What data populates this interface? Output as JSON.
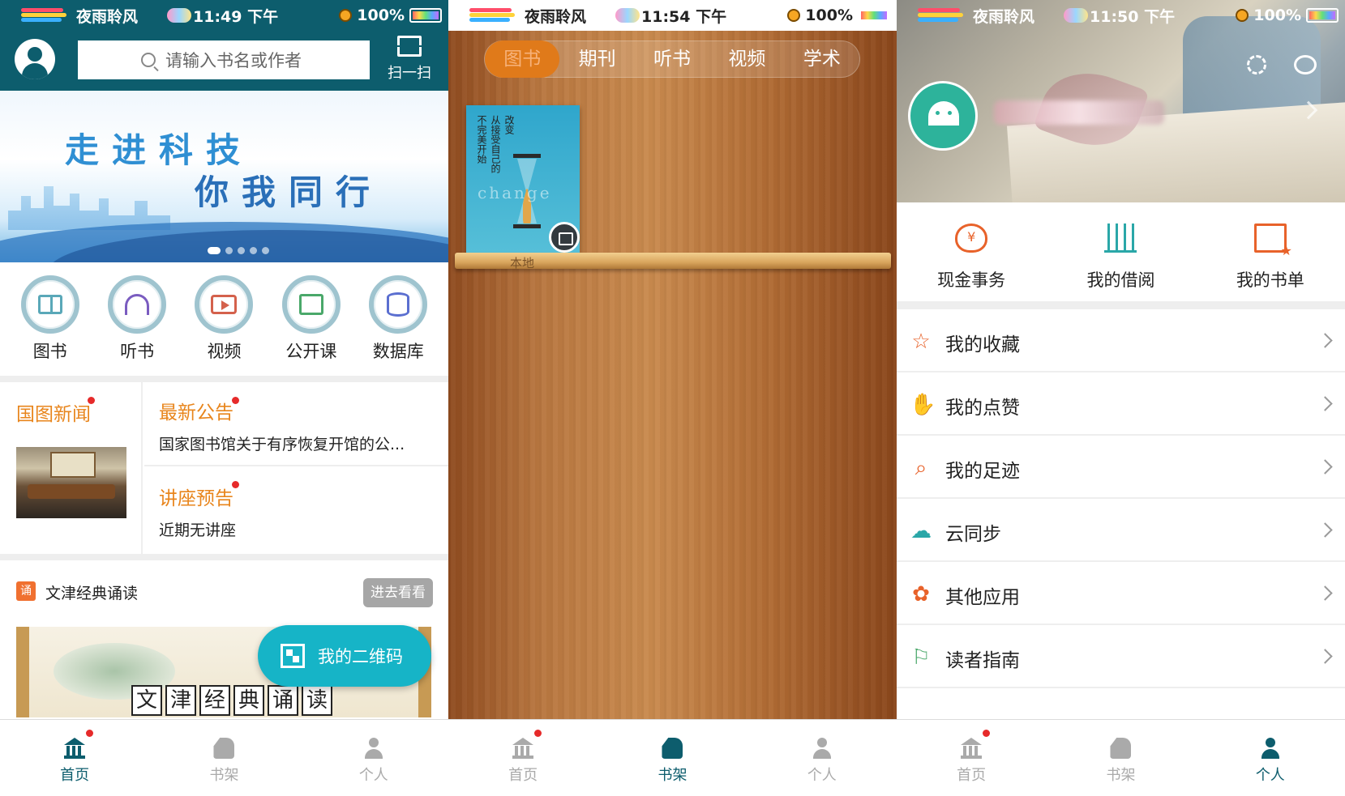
{
  "status_bar": {
    "carrier": "夜雨聆风",
    "battery": "100%",
    "panel1_time": "11:49 下午",
    "panel2_time": "11:54 下午",
    "panel3_time": "11:50 下午"
  },
  "home": {
    "search_placeholder": "请输入书名或作者",
    "scan_label": "扫一扫",
    "banner_line1": "走进科技",
    "banner_line2": "你我同行",
    "nav": [
      {
        "label": "图书",
        "icon": "book-icon"
      },
      {
        "label": "听书",
        "icon": "headphones-icon"
      },
      {
        "label": "视频",
        "icon": "video-icon"
      },
      {
        "label": "公开课",
        "icon": "course-icon"
      },
      {
        "label": "数据库",
        "icon": "database-icon"
      }
    ],
    "news_title": "国图新闻",
    "announce_title": "最新公告",
    "announce_text": "国家图书馆关于有序恢复开馆的公...",
    "lecture_title": "讲座预告",
    "lecture_text": "近期无讲座",
    "classic_title": "文津经典诵读",
    "classic_button": "进去看看",
    "classic_chars": [
      "文",
      "津",
      "经",
      "典",
      "诵",
      "读"
    ],
    "qr_button": "我的二维码"
  },
  "bookshelf": {
    "tabs": [
      "图书",
      "期刊",
      "听书",
      "视频",
      "学术"
    ],
    "active_tab": 0,
    "book_title_cols": [
      "改变",
      "从接受自己的",
      "不完美开始"
    ],
    "book_watermark": "change",
    "shelf_label": "本地"
  },
  "profile": {
    "quick": [
      {
        "label": "现金事务",
        "icon": "money-bag-icon"
      },
      {
        "label": "我的借阅",
        "icon": "borrow-icon"
      },
      {
        "label": "我的书单",
        "icon": "booklist-icon"
      }
    ],
    "menu": [
      {
        "label": "我的收藏",
        "icon": "star-icon",
        "glyph": "☆"
      },
      {
        "label": "我的点赞",
        "icon": "thumbs-up-icon",
        "glyph": "👍"
      },
      {
        "label": "我的足迹",
        "icon": "footprint-icon",
        "glyph": "⌕"
      },
      {
        "label": "云同步",
        "icon": "cloud-sync-icon",
        "glyph": "☁"
      },
      {
        "label": "其他应用",
        "icon": "apps-icon",
        "glyph": "✿"
      },
      {
        "label": "读者指南",
        "icon": "signpost-icon",
        "glyph": "⚐"
      }
    ]
  },
  "tabbar": {
    "home": "首页",
    "shelf": "书架",
    "me": "个人"
  },
  "colors": {
    "primary": "#0d5d6d",
    "accent_orange": "#e8851c",
    "fab": "#16b4c7",
    "shelf_active_tab": "#e07a1a"
  }
}
